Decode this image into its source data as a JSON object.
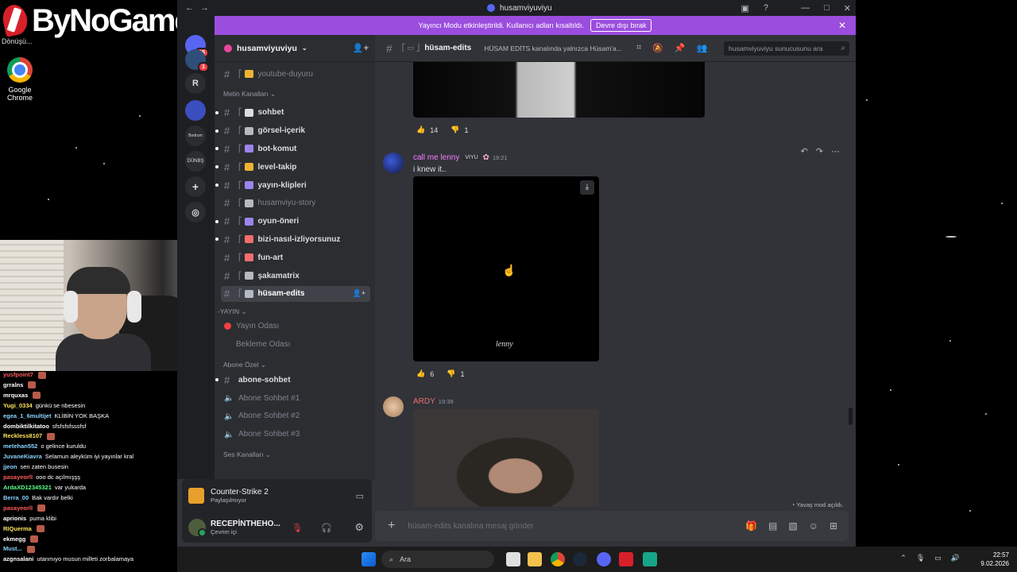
{
  "overlay": {
    "logo_text": "ByNoGame",
    "logo_sub": "Dönüşü...",
    "desktop_icon_label": "Google Chrome"
  },
  "chat_overlay": [
    {
      "user": "yusfpoint7",
      "msg": "",
      "color": "#ff5c5c"
    },
    {
      "user": "grralns",
      "msg": "",
      "color": "#ffffff"
    },
    {
      "user": "mrquxas",
      "msg": "",
      "color": "#ffffff"
    },
    {
      "user": "Yugi_0334",
      "msg": "günkü se nbesesin",
      "color": "#ffe45c"
    },
    {
      "user": "egea_1_6multijet",
      "msg": "KLİBİN YOK BAŞKA",
      "color": "#8ad3ff"
    },
    {
      "user": "dombiktilkitatoo",
      "msg": "sfsfsfsfsssfsf",
      "color": "#ffffff"
    },
    {
      "user": "Reckless8107",
      "msg": "",
      "color": "#ffe45c"
    },
    {
      "user": "metehan552",
      "msg": "o gelince kuruldu",
      "color": "#8ad3ff"
    },
    {
      "user": "JuvaneKiavra",
      "msg": "Selamun aleyküm iyi yayınlar kral",
      "color": "#8ad3ff"
    },
    {
      "user": "jjeon",
      "msg": "sen zaten busesin",
      "color": "#8ad3ff"
    },
    {
      "user": "pasayeorll",
      "msg": "ooo dc açılmışşş",
      "color": "#ff5c5c"
    },
    {
      "user": "ArdaXD12345321",
      "msg": "var yukarda",
      "color": "#5cff8a"
    },
    {
      "user": "Berra_00",
      "msg": "Bak vardır belki",
      "color": "#8ad3ff"
    },
    {
      "user": "pasayeorll",
      "msg": "",
      "color": "#ff5c5c"
    },
    {
      "user": "aprionis",
      "msg": "puma klibi",
      "color": "#ffffff"
    },
    {
      "user": "RIQuerma",
      "msg": "",
      "color": "#ffe45c"
    },
    {
      "user": "ekmegg",
      "msg": "",
      "color": "#ffffff"
    },
    {
      "user": "Must...",
      "msg": "",
      "color": "#8ad3ff"
    },
    {
      "user": "azgnsalani",
      "msg": "utanmıyo musun milleti zorbalamaya",
      "color": "#ffffff"
    }
  ],
  "discord": {
    "window_title": "husamviyuviyu",
    "banner": {
      "text": "Yayıncı Modu etkinleştirildi. Kullanıcı adları kısaltıldı.",
      "button": "Devre dışı bırak"
    },
    "rail": {
      "badge_top": "15",
      "badge_2": "1",
      "letter": "R",
      "label_4": "Bodrum",
      "label_5": "DÜNBŞ"
    },
    "server_name": "husamviyuviyu",
    "channels": [
      {
        "name": "youtube-duyuru",
        "type": "text",
        "muted": true,
        "emoji_color": "#f0b232"
      },
      {
        "cat": "Metin Kanalları"
      },
      {
        "name": "sohbet",
        "type": "text",
        "pip": true,
        "emoji_color": "#dbdee1"
      },
      {
        "name": "görsel-içerik",
        "type": "text",
        "pip": true,
        "emoji_color": "#b5bac1"
      },
      {
        "name": "bot-komut",
        "type": "text",
        "pip": true,
        "emoji_color": "#9b84ec"
      },
      {
        "name": "level-takip",
        "type": "text",
        "pip": true,
        "emoji_color": "#f0b232"
      },
      {
        "name": "yayın-klipleri",
        "type": "text",
        "pip": true,
        "emoji_color": "#9b84ec"
      },
      {
        "name": "husamviyu-story",
        "type": "text",
        "muted": true,
        "emoji_color": "#b5bac1"
      },
      {
        "name": "oyun-öneri",
        "type": "text",
        "pip": true,
        "emoji_color": "#9b84ec"
      },
      {
        "name": "bizi-nasıl-izliyorsunuz",
        "type": "text",
        "pip": true,
        "emoji_color": "#f26d6d"
      },
      {
        "name": "fun-art",
        "type": "text",
        "emoji_color": "#f26d6d"
      },
      {
        "name": "şakamatrix",
        "type": "text",
        "emoji_color": "#b5bac1"
      },
      {
        "name": "hüsam-edits",
        "type": "text",
        "selected": true,
        "emoji_color": "#b5bac1"
      }
    ],
    "voice_cat": "-YAYIN",
    "voice": [
      {
        "name": "Yayın Odası"
      },
      {
        "name": "Bekleme Odası"
      }
    ],
    "abone_cat": "Abone Özel",
    "abone": [
      {
        "name": "abone-sohbet",
        "type": "text"
      },
      {
        "name": "Abone Sohbet #1",
        "type": "voice"
      },
      {
        "name": "Abone Sohbet #2",
        "type": "voice"
      },
      {
        "name": "Abone Sohbet #3",
        "type": "voice"
      }
    ],
    "ses_cat": "Ses Kanalları",
    "game": {
      "title": "Counter-Strike 2",
      "status": "Paylaşılmıyor"
    },
    "user": {
      "name": "RECEPİNTHEHO...",
      "status": "Çevrim içi"
    },
    "header": {
      "channel": "hüsam-edits",
      "topic": "HÜSAM EDİTS kanalında yalnızca Hüsam'a...",
      "search_placeholder": "husamviyuviyu sunucusunu ara"
    },
    "messages": [
      {
        "reactions": [
          {
            "emoji": "👍",
            "count": "14"
          },
          {
            "emoji": "👎",
            "count": "1"
          }
        ]
      },
      {
        "user": "call me lenny",
        "user_color": "#f47fff",
        "tag": "VIYU",
        "time": "19:21",
        "text": "i knew it..",
        "video_caption": "lenny",
        "reactions": [
          {
            "emoji": "👍",
            "count": "6"
          },
          {
            "emoji": "👎",
            "count": "1"
          }
        ]
      },
      {
        "user": "ARDY",
        "user_color": "#f26d6d",
        "time": "19:39"
      }
    ],
    "slow_mode": "Yavaş mod açıldı.",
    "composer_placeholder": "hüsam-edits kanalına mesaj gönder"
  },
  "taskbar": {
    "search_label": "Ara",
    "time": "22:57",
    "date": "9.02.2026"
  }
}
